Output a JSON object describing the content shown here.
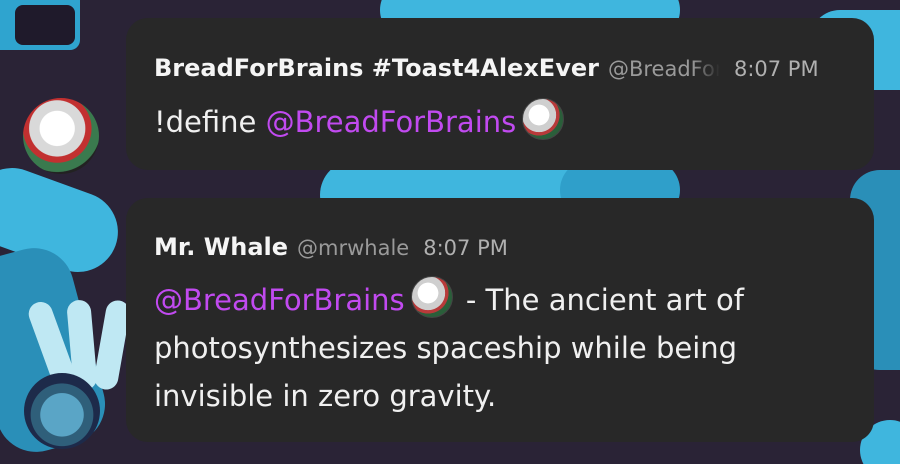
{
  "messages": [
    {
      "author": "BreadForBrains #Toast4AlexEver",
      "handle": "@BreadForBrains",
      "time": "8:07 PM",
      "text_prefix": "!define ",
      "mention": "@BreadForBrains",
      "text_suffix": ""
    },
    {
      "author": "Mr. Whale",
      "handle": "@mrwhale",
      "time": "8:07 PM",
      "text_prefix": "",
      "mention": "@BreadForBrains",
      "text_suffix": " - The ancient art of photosynthesizes spaceship while being invisible in zero gravity."
    }
  ],
  "colors": {
    "mention": "#c14af0",
    "bubble": "#282828",
    "background": "#2a2336",
    "accent_shapes": "#3fb6de"
  },
  "icons": [
    "avatar-bread",
    "avatar-whale",
    "inline-avatar-bread"
  ]
}
